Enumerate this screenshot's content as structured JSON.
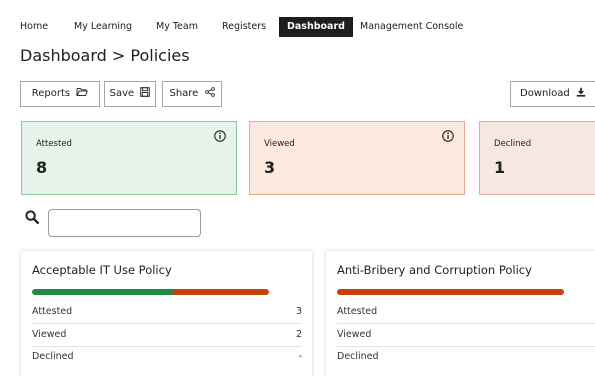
{
  "nav": {
    "items": [
      {
        "label": "Home",
        "active": false
      },
      {
        "label": "My Learning",
        "active": false
      },
      {
        "label": "My Team",
        "active": false
      },
      {
        "label": "Registers",
        "active": false
      },
      {
        "label": "Dashboard",
        "active": true
      },
      {
        "label": "Management Console",
        "active": false
      }
    ]
  },
  "page": {
    "title": "Dashboard > Policies"
  },
  "toolbar": {
    "reports_label": "Reports",
    "save_label": "Save",
    "share_label": "Share",
    "download_label": "Download"
  },
  "stats": [
    {
      "label": "Attested",
      "value": "8",
      "bg": "#e6f3ea",
      "border": "#8fc4a0"
    },
    {
      "label": "Viewed",
      "value": "3",
      "bg": "#fbe9e0",
      "border": "#e7a98c"
    },
    {
      "label": "Declined",
      "value": "1",
      "bg": "#f7e7e3",
      "border": "#dcb0a5"
    }
  ],
  "search": {
    "value": "",
    "placeholder": ""
  },
  "colors": {
    "attested": "#1e8a46",
    "viewed": "#c8420f",
    "declined": "#7a7a7a"
  },
  "policies": [
    {
      "title": "Acceptable IT Use Policy",
      "attested_fraction": 0.6,
      "rows": [
        {
          "label": "Attested",
          "value": "3"
        },
        {
          "label": "Viewed",
          "value": "2"
        },
        {
          "label": "Declined",
          "value": "-"
        }
      ]
    },
    {
      "title": "Anti-Bribery and Corruption Policy",
      "attested_fraction": 0.0,
      "rows": [
        {
          "label": "Attested",
          "value": ""
        },
        {
          "label": "Viewed",
          "value": ""
        },
        {
          "label": "Declined",
          "value": ""
        }
      ]
    }
  ]
}
